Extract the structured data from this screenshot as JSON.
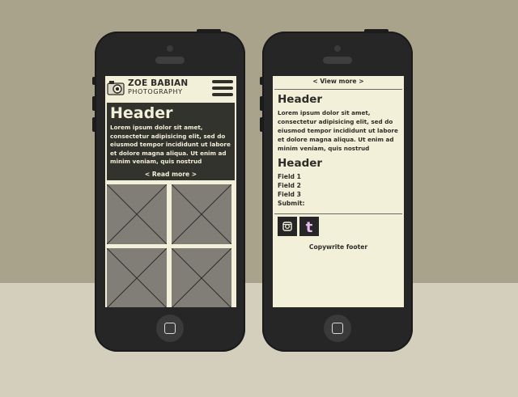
{
  "brand": {
    "name": "ZOE BABIAN",
    "subtitle": "PHOTOGRAPHY"
  },
  "left_screen": {
    "header": "Header",
    "body": "Lorem ipsum dolor sit amet, consectetur adipisicing elit, sed do eiusmod tempor incididunt ut labore et dolore magna aliqua. Ut enim ad minim veniam, quis nostrud",
    "read_more": "< Read more >"
  },
  "right_screen": {
    "view_more": "< View more >",
    "section1_header": "Header",
    "section1_body": "Lorem ipsum dolor sit amet, consectetur adipisicing elit, sed do eiusmod tempor incididunt ut labore et dolore magna aliqua. Ut enim ad minim veniam, quis nostrud",
    "section2_header": "Header",
    "fields": [
      "Field 1",
      "Field 2",
      "Field 3",
      "Submit:"
    ],
    "footer": "Copywrite footer"
  },
  "icons": {
    "camera": "camera-icon",
    "menu": "hamburger-menu-icon",
    "instagram": "instagram-icon",
    "tumblr": "tumblr-icon",
    "home": "home-button-icon"
  },
  "colors": {
    "wall": "#aaa38c",
    "floor": "#d4cfbc",
    "phone_body": "#262626",
    "screen_bg": "#f3f0d9",
    "hero_bg": "#33332e",
    "placeholder": "#807e76",
    "tumblr_accent": "#e9b8f0"
  }
}
